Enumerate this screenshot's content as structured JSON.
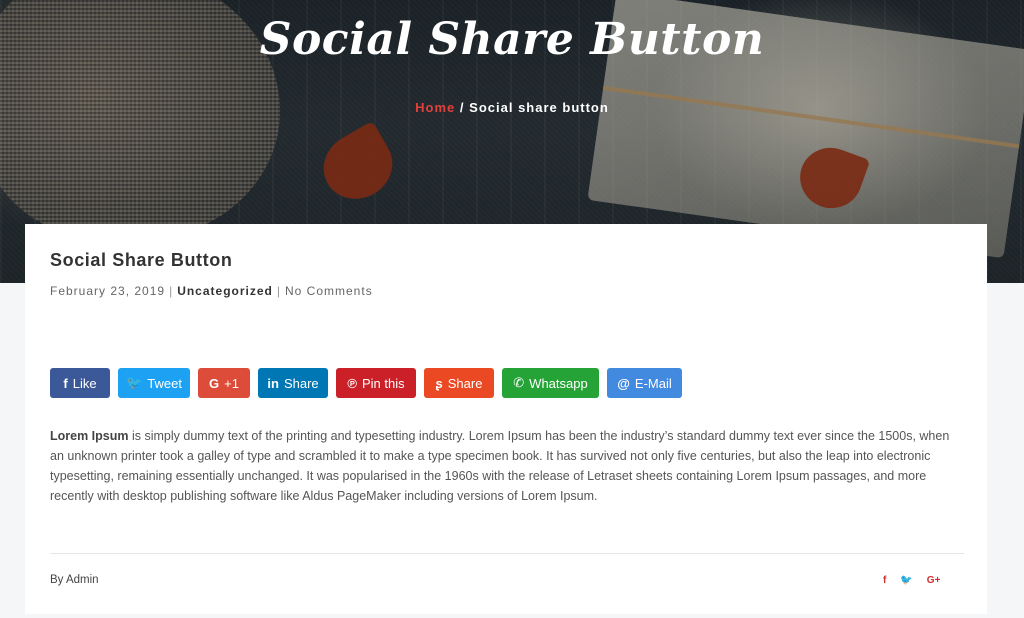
{
  "hero": {
    "title": "Social Share Button",
    "breadcrumb": {
      "home": "Home",
      "separator": "/",
      "current": "Social share button"
    }
  },
  "post": {
    "title": "Social Share Button",
    "date": "February 23, 2019",
    "category": "Uncategorized",
    "comments": "No Comments",
    "body_lead": "Lorem Ipsum",
    "body_text": " is simply dummy text of the printing and typesetting industry. Lorem Ipsum has been the industry’s standard dummy text ever since the 1500s, when an unknown printer took a galley of type and scrambled it to make a type specimen book. It has survived not only five centuries, but also the leap into electronic typesetting, remaining essentially unchanged. It was popularised in the 1960s with the release of Letraset sheets containing Lorem Ipsum passages, and more recently with desktop publishing software like Aldus PageMaker including versions of Lorem Ipsum.",
    "author": "By Admin"
  },
  "share_buttons": [
    {
      "icon": "facebook-icon",
      "glyph": "f",
      "label": "Like",
      "color": "#3b5998"
    },
    {
      "icon": "twitter-icon",
      "glyph": "🐦",
      "label": "Tweet",
      "color": "#1da1f2"
    },
    {
      "icon": "google-plus-icon",
      "glyph": "G",
      "label": "+1",
      "color": "#dd4b39"
    },
    {
      "icon": "linkedin-icon",
      "glyph": "in",
      "label": "Share",
      "color": "#0077b5"
    },
    {
      "icon": "pinterest-icon",
      "glyph": "℗",
      "label": "Pin this",
      "color": "#cb2027"
    },
    {
      "icon": "stumbleupon-icon",
      "glyph": "ʂ",
      "label": "Share",
      "color": "#eb4924"
    },
    {
      "icon": "whatsapp-icon",
      "glyph": "✆",
      "label": "Whatsapp",
      "color": "#25a336"
    },
    {
      "icon": "email-icon",
      "glyph": "@",
      "label": "E-Mail",
      "color": "#4289e0"
    }
  ],
  "footer_icons": [
    {
      "icon": "facebook-icon",
      "glyph": "f"
    },
    {
      "icon": "twitter-icon",
      "glyph": "🐦"
    },
    {
      "icon": "google-plus-icon",
      "glyph": "G+"
    }
  ]
}
